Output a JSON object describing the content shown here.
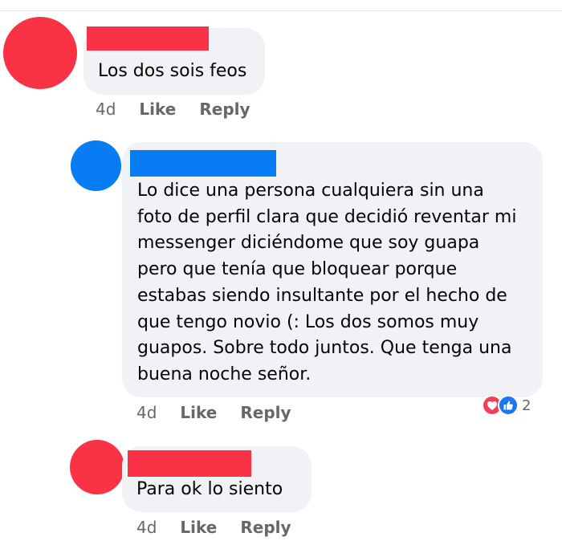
{
  "comments": [
    {
      "author_color": "#fa3246",
      "text": "Los dos sois feos",
      "time": "4d",
      "like_label": "Like",
      "reply_label": "Reply"
    },
    {
      "author_color": "#087cf2",
      "text": "Lo dice una persona cualquiera sin una\nfoto de perfil clara que decidió reventar mi\nmessenger diciéndome que soy guapa\npero que tenía que bloquear porque\nestabas siendo insultante por el hecho de\nque tengo novio (: Los dos somos muy\nguapos. Sobre todo juntos. Que tenga una\nbuena noche señor.",
      "time": "4d",
      "like_label": "Like",
      "reply_label": "Reply",
      "reactions": {
        "icons": [
          "heart-icon",
          "thumbs-up-icon"
        ],
        "count": "2"
      }
    },
    {
      "author_color": "#fa3246",
      "text": "Para ok lo siento",
      "time": "4d",
      "like_label": "Like",
      "reply_label": "Reply"
    }
  ]
}
